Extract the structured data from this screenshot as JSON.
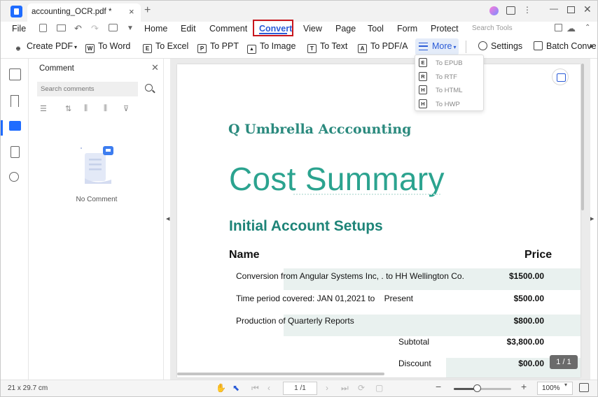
{
  "window": {
    "tab_title": "accounting_OCR.pdf *",
    "tab_close": "×",
    "tab_add": "+"
  },
  "menu": {
    "file": "File",
    "items": [
      "Home",
      "Edit",
      "Comment",
      "Convert",
      "View",
      "Page",
      "Tool",
      "Form",
      "Protect"
    ],
    "active": "Convert",
    "search_tools": "Search Tools"
  },
  "toolbar": {
    "create_pdf": "Create PDF",
    "to_word": "To Word",
    "to_excel": "To Excel",
    "to_ppt": "To PPT",
    "to_image": "To Image",
    "to_text": "To Text",
    "to_pdfa": "To PDF/A",
    "more": "More",
    "settings": "Settings",
    "batch_convert": "Batch Conve",
    "icons": {
      "word": "W",
      "excel": "E",
      "ppt": "P",
      "text": "T",
      "pdfa": "A"
    }
  },
  "more_menu": {
    "items": [
      {
        "label": "To EPUB",
        "icon": "E"
      },
      {
        "label": "To RTF",
        "icon": "R"
      },
      {
        "label": "To HTML",
        "icon": "H"
      },
      {
        "label": "To HWP",
        "icon": "H"
      }
    ]
  },
  "comment_panel": {
    "title": "Comment",
    "search_placeholder": "Search comments",
    "empty_text": "No Comment"
  },
  "document": {
    "company": "Q Umbrella Acccounting",
    "title": "Cost Summary",
    "section": "Initial Account Setups",
    "col_name": "Name",
    "col_price": "Price",
    "rows": [
      {
        "desc": "Conversion from Angular Systems Inc, . to HH Wellington Co.",
        "price": "$1500.00"
      },
      {
        "desc": "Time period covered: JAN 01,2021 to    Present",
        "price": "$500.00"
      },
      {
        "desc": "Production of Quarterly Reports",
        "price": "$800.00"
      }
    ],
    "subtotal_label": "Subtotal",
    "subtotal_value": "$3,800.00",
    "discount_label": "Discount",
    "discount_value": "$00.00",
    "page_badge": "1 / 1"
  },
  "status": {
    "page_size": "21 x 29.7 cm",
    "page_field": "1 /1",
    "zoom_level": "100%",
    "zoom_fraction": 0.4
  },
  "colors": {
    "accent": "#2a5bd7",
    "highlight_box": "#c8161d",
    "teal_heading": "#2ba38f"
  }
}
